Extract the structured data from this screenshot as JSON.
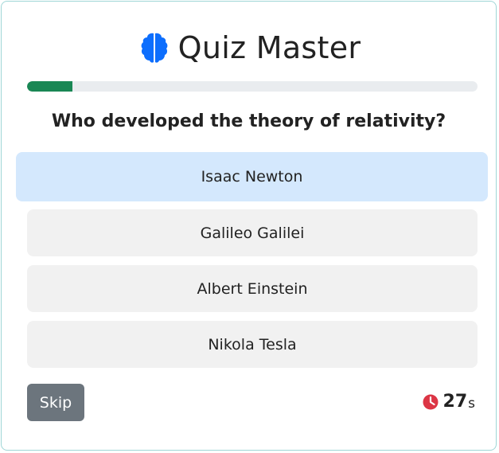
{
  "header": {
    "title": "Quiz Master",
    "icon": "brain-icon"
  },
  "progress": {
    "fraction": 0.1,
    "color": "#198754"
  },
  "question": {
    "text": "Who developed the theory of relativity?"
  },
  "answers": [
    {
      "label": "Isaac Newton",
      "hovered": true
    },
    {
      "label": "Galileo Galilei",
      "hovered": false
    },
    {
      "label": "Albert Einstein",
      "hovered": false
    },
    {
      "label": "Nikola Tesla",
      "hovered": false
    }
  ],
  "footer": {
    "skip_label": "Skip",
    "timer_value": "27",
    "timer_unit": "s",
    "timer_icon": "clock-icon"
  },
  "colors": {
    "accent": "#0d6efd",
    "timer_icon": "#dc3545",
    "hover_answer": "#d4e8fd",
    "skip_button": "#6c757d"
  }
}
